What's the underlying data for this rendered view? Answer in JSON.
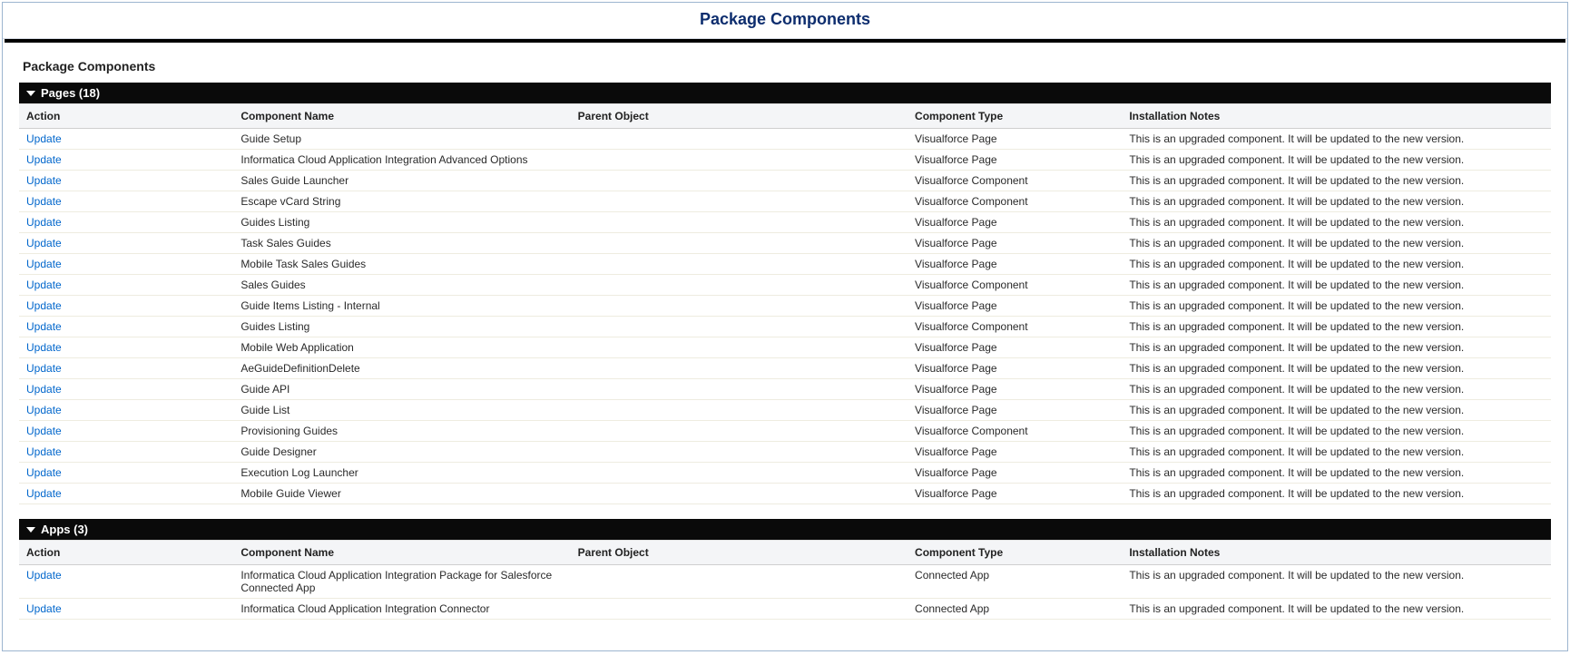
{
  "header": {
    "title": "Package Components"
  },
  "panel": {
    "title": "Package Components"
  },
  "columns": {
    "action": "Action",
    "componentName": "Component Name",
    "parentObject": "Parent Object",
    "componentType": "Component Type",
    "installNotes": "Installation Notes"
  },
  "upgradeNote": "This is an upgraded component. It will be updated to the new version.",
  "actionLabel": "Update",
  "sections": {
    "pages": {
      "title": "Pages (18)",
      "rows": [
        {
          "name": "Guide Setup",
          "parent": "",
          "type": "Visualforce Page"
        },
        {
          "name": "Informatica Cloud Application Integration Advanced Options",
          "parent": "",
          "type": "Visualforce Page"
        },
        {
          "name": "Sales Guide Launcher",
          "parent": "",
          "type": "Visualforce Component"
        },
        {
          "name": "Escape vCard String",
          "parent": "",
          "type": "Visualforce Component"
        },
        {
          "name": "Guides Listing",
          "parent": "",
          "type": "Visualforce Page"
        },
        {
          "name": "Task Sales Guides",
          "parent": "",
          "type": "Visualforce Page"
        },
        {
          "name": "Mobile Task Sales Guides",
          "parent": "",
          "type": "Visualforce Page"
        },
        {
          "name": "Sales Guides",
          "parent": "",
          "type": "Visualforce Component"
        },
        {
          "name": "Guide Items Listing - Internal",
          "parent": "",
          "type": "Visualforce Page"
        },
        {
          "name": "Guides Listing",
          "parent": "",
          "type": "Visualforce Component"
        },
        {
          "name": "Mobile Web Application",
          "parent": "",
          "type": "Visualforce Page"
        },
        {
          "name": "AeGuideDefinitionDelete",
          "parent": "",
          "type": "Visualforce Page"
        },
        {
          "name": "Guide API",
          "parent": "",
          "type": "Visualforce Page"
        },
        {
          "name": "Guide List",
          "parent": "",
          "type": "Visualforce Page"
        },
        {
          "name": "Provisioning Guides",
          "parent": "",
          "type": "Visualforce Component"
        },
        {
          "name": "Guide Designer",
          "parent": "",
          "type": "Visualforce Page"
        },
        {
          "name": "Execution Log Launcher",
          "parent": "",
          "type": "Visualforce Page"
        },
        {
          "name": "Mobile Guide Viewer",
          "parent": "",
          "type": "Visualforce Page"
        }
      ]
    },
    "apps": {
      "title": "Apps (3)",
      "rows": [
        {
          "name": "Informatica Cloud Application Integration Package for Salesforce Connected App",
          "parent": "",
          "type": "Connected App"
        },
        {
          "name": "Informatica Cloud Application Integration Connector",
          "parent": "",
          "type": "Connected App"
        }
      ]
    }
  }
}
